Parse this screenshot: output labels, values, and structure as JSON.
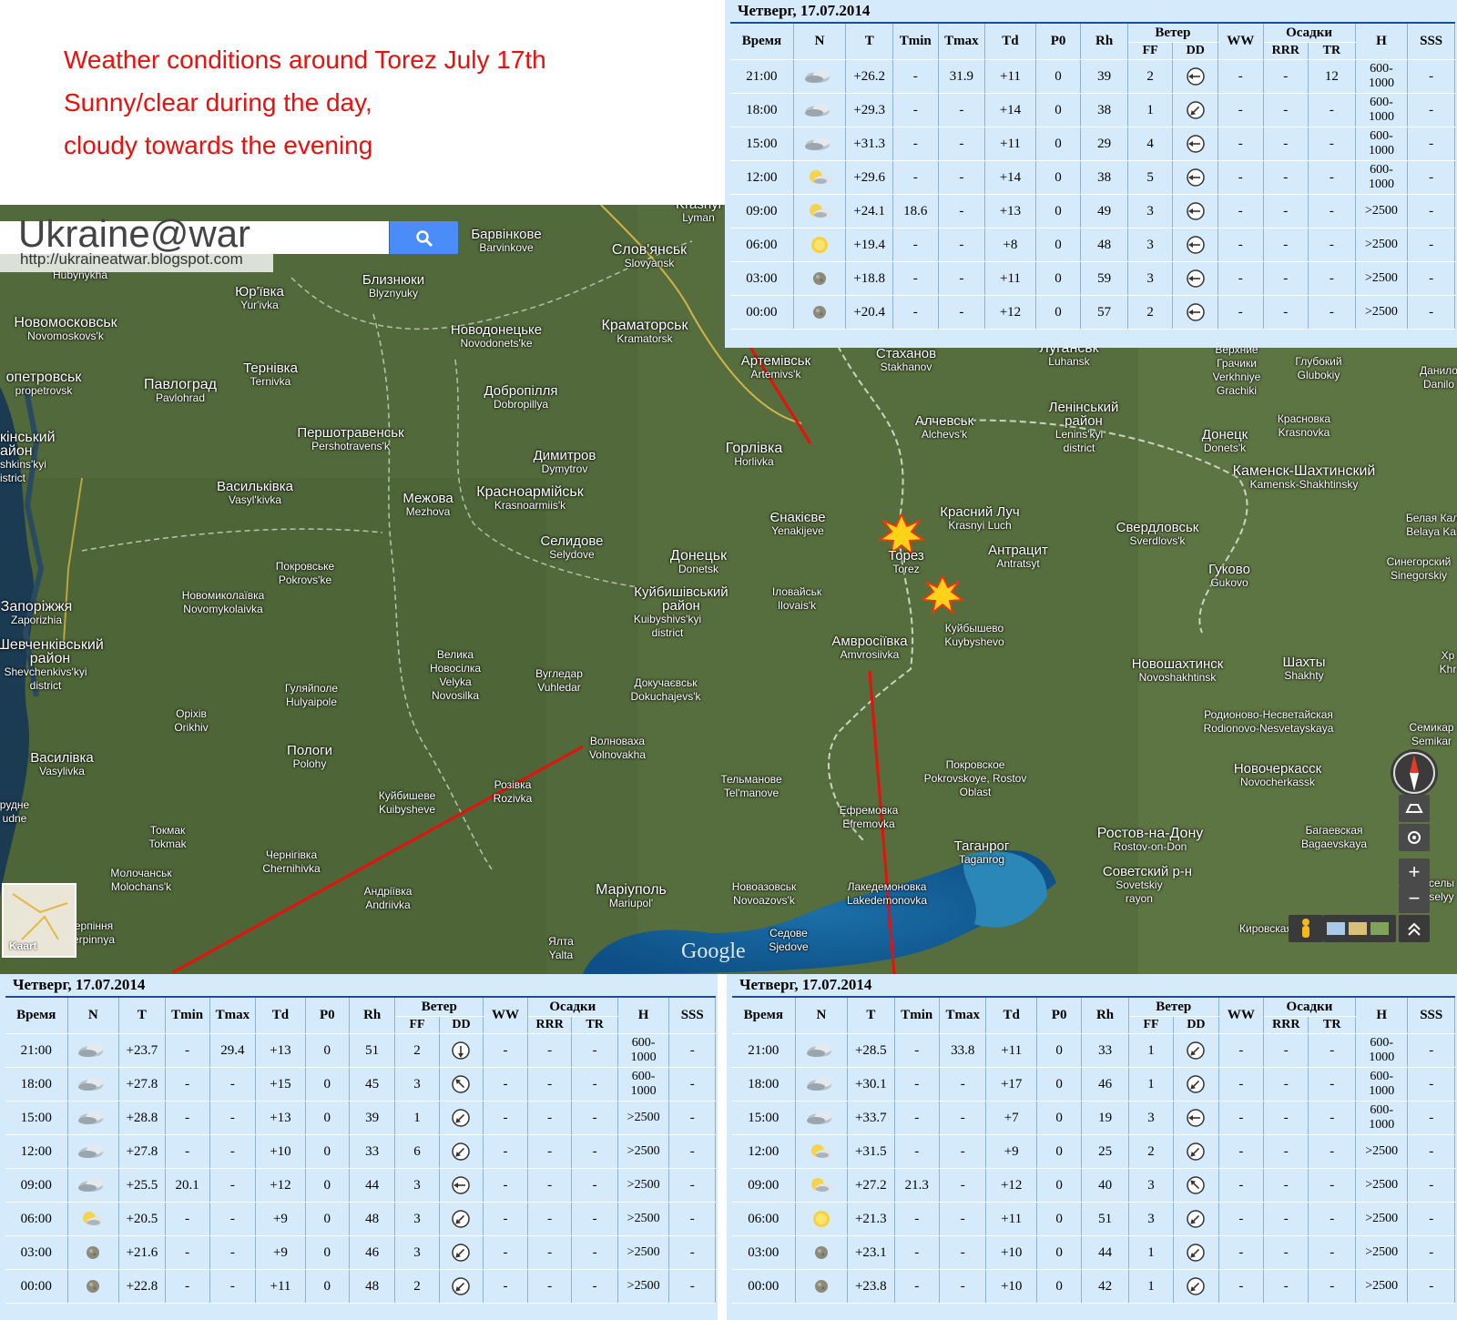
{
  "caption": {
    "lines": [
      "Weather conditions around Torez July 17th",
      "Sunny/clear during the day,",
      "cloudy towards the evening"
    ]
  },
  "watermark": {
    "title": "Ukraine@war",
    "url": "http://ukraineatwar.blogspot.com"
  },
  "map": {
    "google_logo": "Google",
    "thumbnail_label": "Kaart",
    "colors": {
      "annotation_line": "#e8100d",
      "explosion": "#ffd21a"
    },
    "explosion_icons": 2,
    "places": [
      {
        "p": "Барвінкове",
        "s": "Barvinkove"
      },
      {
        "p": "Слов'янськ",
        "s": "Slovyansk"
      },
      {
        "p": "Krasnyi",
        "s": "Lyman"
      },
      {
        "p": "Юр'ївка",
        "s": "Yur'ivka"
      },
      {
        "p": "Близнюки",
        "s": "Blyznyuky"
      },
      {
        "p": "Новомосковськ",
        "s": "Novomoskovs'k"
      },
      {
        "p": "Новодонецьке",
        "s": "Novodonets'ke"
      },
      {
        "p": "Краматорськ",
        "s": "Kramatorsk"
      },
      {
        "p": "Hubynykha",
        "s": ""
      },
      {
        "p": "опетровськ",
        "s": "propetrovsk"
      },
      {
        "p": "Тернівка",
        "s": "Ternivka"
      },
      {
        "p": "Павлоград",
        "s": "Pavlohrad"
      },
      {
        "p": "Добропілля",
        "s": "Dobropillya"
      },
      {
        "p": "Артемівськ",
        "s": "Artemivs'k"
      },
      {
        "p": "Стаханов",
        "s": "Stakhanov"
      },
      {
        "p": "Луганськ",
        "s": "Luhansk"
      },
      {
        "p": "Верхние Грачики",
        "s": "Verkhniye Grachiki"
      },
      {
        "p": "Глубокий",
        "s": "Glubokiy"
      },
      {
        "p": "Данило",
        "s": "Danilo"
      },
      {
        "p": "кінський айон",
        "s": "shkins'kyi istrict"
      },
      {
        "p": "Першотравенськ",
        "s": "Pershotravens'k"
      },
      {
        "p": "Димитров",
        "s": "Dymytrov"
      },
      {
        "p": "Горлівка",
        "s": "Horlivka"
      },
      {
        "p": "Алчевськ",
        "s": "Alchevs'k"
      },
      {
        "p": "Ленінський район",
        "s": "Lenins'kyi district"
      },
      {
        "p": "Донецк",
        "s": "Donets'k"
      },
      {
        "p": "Красновка",
        "s": "Krasnovka"
      },
      {
        "p": "Васильківка",
        "s": "Vasyl'kivka"
      },
      {
        "p": "Межова",
        "s": "Mezhova"
      },
      {
        "p": "Красноармійськ",
        "s": "Krasnoarmiis'k"
      },
      {
        "p": "Каменск-Шахтинский",
        "s": "Kamensk-Shakhtinsky"
      },
      {
        "p": "Єнакієве",
        "s": "Yenakijeve"
      },
      {
        "p": "Красний Луч",
        "s": "Krasnyi Luch"
      },
      {
        "p": "Свердловськ",
        "s": "Sverdlovs'k"
      },
      {
        "p": "Белая Кал",
        "s": "Belaya Kal"
      },
      {
        "p": "Селидове",
        "s": "Selydove"
      },
      {
        "p": "Донецьк",
        "s": "Donetsk"
      },
      {
        "p": "Торез",
        "s": "Torez"
      },
      {
        "p": "Антрацит",
        "s": "Antratsyt"
      },
      {
        "p": "Покровське",
        "s": "Pokrovs'ke"
      },
      {
        "p": "Гуково",
        "s": "Gukovo"
      },
      {
        "p": "Синегорский",
        "s": "Sinegorskiy"
      },
      {
        "p": "Запоріжжя",
        "s": "Zaporizhia"
      },
      {
        "p": "Новомиколаївка",
        "s": "Novomykolaivka"
      },
      {
        "p": "Куйбишівський район",
        "s": "Kuibyshivs'kyi district"
      },
      {
        "p": "Іловайськ",
        "s": "Ilovais'k"
      },
      {
        "p": "Куйбышево",
        "s": "Kuybyshevo"
      },
      {
        "p": "Амвросіївка",
        "s": "Amvrosiivka"
      },
      {
        "p": "Шевченківський район",
        "s": "Shevchenkivs'kyi district"
      },
      {
        "p": "Велика Новосілка",
        "s": "Velyka Novosilka"
      },
      {
        "p": "Вугледар",
        "s": "Vuhledar"
      },
      {
        "p": "Гуляйполе",
        "s": "Hulyaipole"
      },
      {
        "p": "Докучаєвськ",
        "s": "Dokuchajevs'k"
      },
      {
        "p": "Новошахтинск",
        "s": "Novoshakhtinsk"
      },
      {
        "p": "Шахты",
        "s": "Shakhty"
      },
      {
        "p": "Оріхів",
        "s": "Orikhiv"
      },
      {
        "p": "Родионово-Несветайская",
        "s": "Rodionovo-Nesvetayskaya"
      },
      {
        "p": "Волноваха",
        "s": "Volnovakha"
      },
      {
        "p": "Семикар",
        "s": "Semikar"
      },
      {
        "p": "Василівка",
        "s": "Vasylivka"
      },
      {
        "p": "Пологи",
        "s": "Polohy"
      },
      {
        "p": "Покровское",
        "s": "Pokrovskoye, Rostov Oblast"
      },
      {
        "p": "Новочеркасск",
        "s": "Novocherkassk"
      },
      {
        "p": "Тельманове",
        "s": "Tel'manove"
      },
      {
        "p": "Розівка",
        "s": "Rozivka"
      },
      {
        "p": "рудне",
        "s": "udne"
      },
      {
        "p": "Куйбишеве",
        "s": "Kuibysheve"
      },
      {
        "p": "Ефремовка",
        "s": "Efremovka"
      },
      {
        "p": "Токмак",
        "s": "Tokmak"
      },
      {
        "p": "Ростов-на-Дону",
        "s": "Rostov-on-Don"
      },
      {
        "p": "Багаевская",
        "s": "Bagaevskaya"
      },
      {
        "p": "Таганрог",
        "s": "Taganrog"
      },
      {
        "p": "Чернігівка",
        "s": "Chernihivka"
      },
      {
        "p": "Молочанськ",
        "s": "Molochans'k"
      },
      {
        "p": "Советский р-н",
        "s": "Sovetskiy rayon"
      },
      {
        "p": "Маріуполь",
        "s": "Mariupol'"
      },
      {
        "p": "Новоазовськ",
        "s": "Novoazovs'k"
      },
      {
        "p": "Лакедемоновка",
        "s": "Lakedemonovka"
      },
      {
        "p": "Андріївка",
        "s": "Andriivka"
      },
      {
        "p": "селы",
        "s": "selyy"
      },
      {
        "p": "ерпіння",
        "s": "erpinnya"
      },
      {
        "p": "Седове",
        "s": "Sjedove"
      },
      {
        "p": "Ялта",
        "s": "Yalta"
      },
      {
        "p": "Кировская",
        "s": "Kirovskaya"
      },
      {
        "p": "Хр",
        "s": "Khr"
      }
    ]
  },
  "weather_header": {
    "date": "Четверг, 17.07.2014",
    "cols": [
      "Время",
      "N",
      "T",
      "Tmin",
      "Tmax",
      "Td",
      "P0",
      "Rh",
      "Ветер",
      "WW",
      "Осадки",
      "H",
      "SSS"
    ],
    "wind_sub": [
      "FF",
      "DD"
    ],
    "precip_sub": [
      "RRR",
      "TR"
    ]
  },
  "panels": [
    {
      "id": "top",
      "rows": [
        {
          "time": "21:00",
          "n": "cloudy",
          "t": "+26.2",
          "tmin": "-",
          "tmax": "31.9",
          "td": "+11",
          "p0": "0",
          "rh": "39",
          "ff": "2",
          "dd": "W",
          "ww": "-",
          "rrr": "-",
          "tr": "12",
          "h": [
            "600-",
            "1000"
          ],
          "sss": "-"
        },
        {
          "time": "18:00",
          "n": "cloudy",
          "t": "+29.3",
          "tmin": "-",
          "tmax": "-",
          "td": "+14",
          "p0": "0",
          "rh": "38",
          "ff": "1",
          "dd": "SW",
          "ww": "-",
          "rrr": "-",
          "tr": "-",
          "h": [
            "600-",
            "1000"
          ],
          "sss": "-"
        },
        {
          "time": "15:00",
          "n": "cloudy",
          "t": "+31.3",
          "tmin": "-",
          "tmax": "-",
          "td": "+11",
          "p0": "0",
          "rh": "29",
          "ff": "4",
          "dd": "W",
          "ww": "-",
          "rrr": "-",
          "tr": "-",
          "h": [
            "600-",
            "1000"
          ],
          "sss": "-"
        },
        {
          "time": "12:00",
          "n": "partly",
          "t": "+29.6",
          "tmin": "-",
          "tmax": "-",
          "td": "+14",
          "p0": "0",
          "rh": "38",
          "ff": "5",
          "dd": "W",
          "ww": "-",
          "rrr": "-",
          "tr": "-",
          "h": [
            "600-",
            "1000"
          ],
          "sss": "-"
        },
        {
          "time": "09:00",
          "n": "partly",
          "t": "+24.1",
          "tmin": "18.6",
          "tmax": "-",
          "td": "+13",
          "p0": "0",
          "rh": "49",
          "ff": "3",
          "dd": "W",
          "ww": "-",
          "rrr": "-",
          "tr": "-",
          "h": [
            ">2500"
          ],
          "sss": "-"
        },
        {
          "time": "06:00",
          "n": "sun",
          "t": "+19.4",
          "tmin": "-",
          "tmax": "-",
          "td": "+8",
          "p0": "0",
          "rh": "48",
          "ff": "3",
          "dd": "W",
          "ww": "-",
          "rrr": "-",
          "tr": "-",
          "h": [
            ">2500"
          ],
          "sss": "-"
        },
        {
          "time": "03:00",
          "n": "moon",
          "t": "+18.8",
          "tmin": "-",
          "tmax": "-",
          "td": "+11",
          "p0": "0",
          "rh": "59",
          "ff": "3",
          "dd": "W",
          "ww": "-",
          "rrr": "-",
          "tr": "-",
          "h": [
            ">2500"
          ],
          "sss": "-"
        },
        {
          "time": "00:00",
          "n": "moon",
          "t": "+20.4",
          "tmin": "-",
          "tmax": "-",
          "td": "+12",
          "p0": "0",
          "rh": "57",
          "ff": "2",
          "dd": "W",
          "ww": "-",
          "rrr": "-",
          "tr": "-",
          "h": [
            ">2500"
          ],
          "sss": "-"
        }
      ]
    },
    {
      "id": "bottom-left",
      "rows": [
        {
          "time": "21:00",
          "n": "cloudy",
          "t": "+23.7",
          "tmin": "-",
          "tmax": "29.4",
          "td": "+13",
          "p0": "0",
          "rh": "51",
          "ff": "2",
          "dd": "S",
          "ww": "-",
          "rrr": "-",
          "tr": "-",
          "h": [
            "600-",
            "1000"
          ],
          "sss": "-"
        },
        {
          "time": "18:00",
          "n": "cloudy",
          "t": "+27.8",
          "tmin": "-",
          "tmax": "-",
          "td": "+15",
          "p0": "0",
          "rh": "45",
          "ff": "3",
          "dd": "NW",
          "ww": "-",
          "rrr": "-",
          "tr": "-",
          "h": [
            "600-",
            "1000"
          ],
          "sss": "-"
        },
        {
          "time": "15:00",
          "n": "cloudy",
          "t": "+28.8",
          "tmin": "-",
          "tmax": "-",
          "td": "+13",
          "p0": "0",
          "rh": "39",
          "ff": "1",
          "dd": "SW",
          "ww": "-",
          "rrr": "-",
          "tr": "-",
          "h": [
            ">2500"
          ],
          "sss": "-"
        },
        {
          "time": "12:00",
          "n": "cloudy",
          "t": "+27.8",
          "tmin": "-",
          "tmax": "-",
          "td": "+10",
          "p0": "0",
          "rh": "33",
          "ff": "6",
          "dd": "SW",
          "ww": "-",
          "rrr": "-",
          "tr": "-",
          "h": [
            ">2500"
          ],
          "sss": "-"
        },
        {
          "time": "09:00",
          "n": "cloudy",
          "t": "+25.5",
          "tmin": "20.1",
          "tmax": "-",
          "td": "+12",
          "p0": "0",
          "rh": "44",
          "ff": "3",
          "dd": "W",
          "ww": "-",
          "rrr": "-",
          "tr": "-",
          "h": [
            ">2500"
          ],
          "sss": "-"
        },
        {
          "time": "06:00",
          "n": "partly",
          "t": "+20.5",
          "tmin": "-",
          "tmax": "-",
          "td": "+9",
          "p0": "0",
          "rh": "48",
          "ff": "3",
          "dd": "SW",
          "ww": "-",
          "rrr": "-",
          "tr": "-",
          "h": [
            ">2500"
          ],
          "sss": "-"
        },
        {
          "time": "03:00",
          "n": "moon",
          "t": "+21.6",
          "tmin": "-",
          "tmax": "-",
          "td": "+9",
          "p0": "0",
          "rh": "46",
          "ff": "3",
          "dd": "SW",
          "ww": "-",
          "rrr": "-",
          "tr": "-",
          "h": [
            ">2500"
          ],
          "sss": "-"
        },
        {
          "time": "00:00",
          "n": "moon",
          "t": "+22.8",
          "tmin": "-",
          "tmax": "-",
          "td": "+11",
          "p0": "0",
          "rh": "48",
          "ff": "2",
          "dd": "SW",
          "ww": "-",
          "rrr": "-",
          "tr": "-",
          "h": [
            ">2500"
          ],
          "sss": "-"
        }
      ]
    },
    {
      "id": "bottom-right",
      "rows": [
        {
          "time": "21:00",
          "n": "cloudy",
          "t": "+28.5",
          "tmin": "-",
          "tmax": "33.8",
          "td": "+11",
          "p0": "0",
          "rh": "33",
          "ff": "1",
          "dd": "SW",
          "ww": "-",
          "rrr": "-",
          "tr": "-",
          "h": [
            "600-",
            "1000"
          ],
          "sss": "-"
        },
        {
          "time": "18:00",
          "n": "cloudy",
          "t": "+30.1",
          "tmin": "-",
          "tmax": "-",
          "td": "+17",
          "p0": "0",
          "rh": "46",
          "ff": "1",
          "dd": "SW",
          "ww": "-",
          "rrr": "-",
          "tr": "-",
          "h": [
            "600-",
            "1000"
          ],
          "sss": "-"
        },
        {
          "time": "15:00",
          "n": "cloudy",
          "t": "+33.7",
          "tmin": "-",
          "tmax": "-",
          "td": "+7",
          "p0": "0",
          "rh": "19",
          "ff": "3",
          "dd": "W",
          "ww": "-",
          "rrr": "-",
          "tr": "-",
          "h": [
            "600-",
            "1000"
          ],
          "sss": "-"
        },
        {
          "time": "12:00",
          "n": "partly",
          "t": "+31.5",
          "tmin": "-",
          "tmax": "-",
          "td": "+9",
          "p0": "0",
          "rh": "25",
          "ff": "2",
          "dd": "SW",
          "ww": "-",
          "rrr": "-",
          "tr": "-",
          "h": [
            ">2500"
          ],
          "sss": "-"
        },
        {
          "time": "09:00",
          "n": "partly",
          "t": "+27.2",
          "tmin": "21.3",
          "tmax": "-",
          "td": "+12",
          "p0": "0",
          "rh": "40",
          "ff": "3",
          "dd": "NW",
          "ww": "-",
          "rrr": "-",
          "tr": "-",
          "h": [
            ">2500"
          ],
          "sss": "-"
        },
        {
          "time": "06:00",
          "n": "sun",
          "t": "+21.3",
          "tmin": "-",
          "tmax": "-",
          "td": "+11",
          "p0": "0",
          "rh": "51",
          "ff": "3",
          "dd": "SW",
          "ww": "-",
          "rrr": "-",
          "tr": "-",
          "h": [
            ">2500"
          ],
          "sss": "-"
        },
        {
          "time": "03:00",
          "n": "moon",
          "t": "+23.1",
          "tmin": "-",
          "tmax": "-",
          "td": "+10",
          "p0": "0",
          "rh": "44",
          "ff": "1",
          "dd": "SW",
          "ww": "-",
          "rrr": "-",
          "tr": "-",
          "h": [
            ">2500"
          ],
          "sss": "-"
        },
        {
          "time": "00:00",
          "n": "moon",
          "t": "+23.8",
          "tmin": "-",
          "tmax": "-",
          "td": "+10",
          "p0": "0",
          "rh": "42",
          "ff": "1",
          "dd": "SW",
          "ww": "-",
          "rrr": "-",
          "tr": "-",
          "h": [
            ">2500"
          ],
          "sss": "-"
        }
      ]
    }
  ]
}
